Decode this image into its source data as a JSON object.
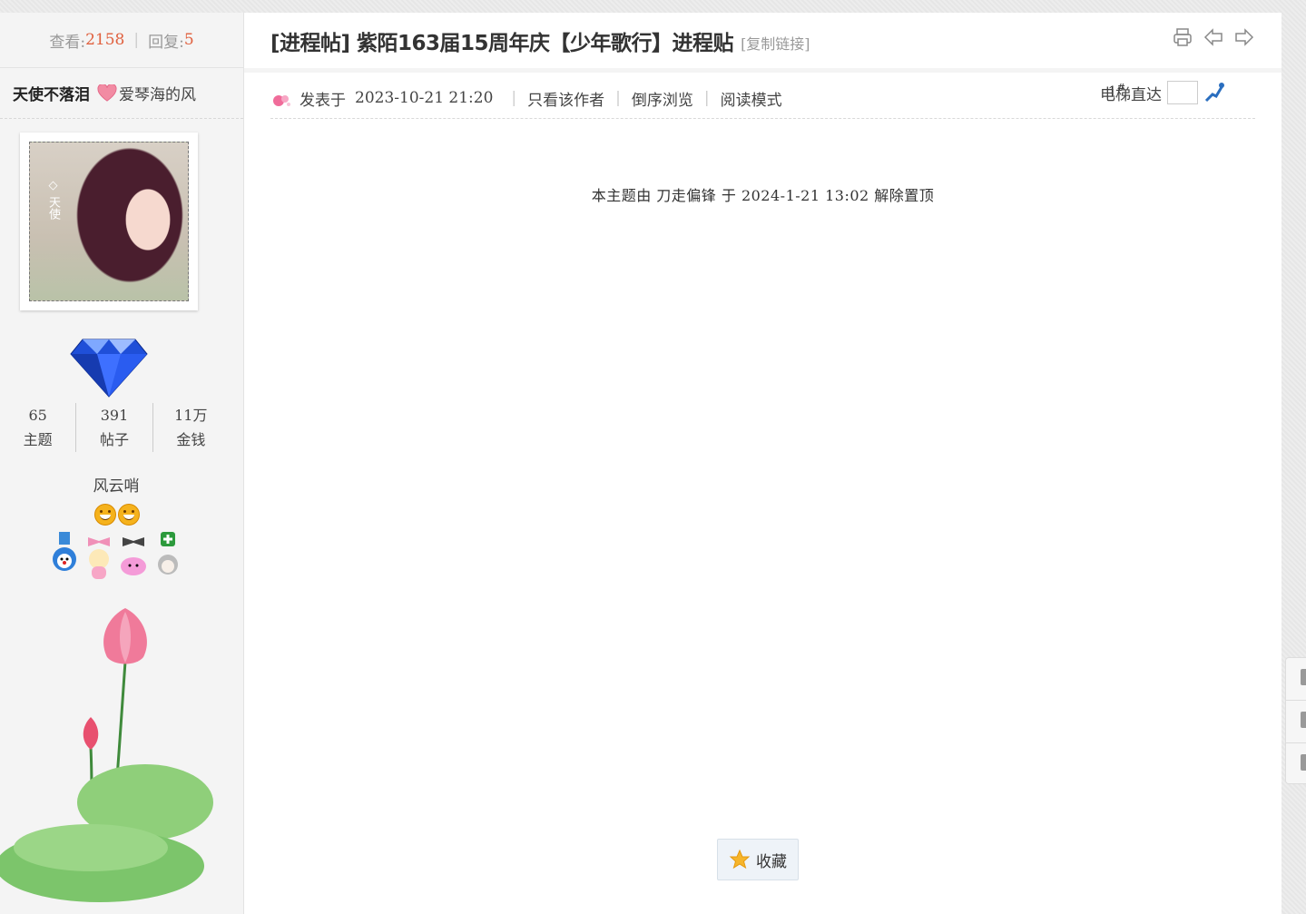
{
  "stats": {
    "views_label": "查看:",
    "views": "2158",
    "replies_label": "回复:",
    "replies": "5"
  },
  "author": {
    "name": "天使不落泪",
    "slogan": "爱琴海的风",
    "avatar_text": "◇ 天使"
  },
  "user_counts": [
    {
      "value": "65",
      "label": "主题"
    },
    {
      "value": "391",
      "label": "帖子"
    },
    {
      "value": "11万",
      "label": "金钱"
    }
  ],
  "group_name": "风云哨",
  "thread": {
    "title": "[进程帖] 紫陌163届15周年庆【少年歌行】进程贴",
    "copy_link": "[复制链接]"
  },
  "post": {
    "posted_label": "发表于",
    "posted_time": "2023-10-21 21:20",
    "only_author": "只看该作者",
    "reverse": "倒序浏览",
    "read_mode": "阅读模式",
    "floor": "1",
    "floor_mark": "#",
    "elevator_label": "电梯直达"
  },
  "notice": "本主题由 刀走偏锋 于 2024-1-21 13:02 解除置顶",
  "favorite_label": "收藏",
  "colors": {
    "accent": "#e0603e",
    "page_bg": "#ededed"
  }
}
